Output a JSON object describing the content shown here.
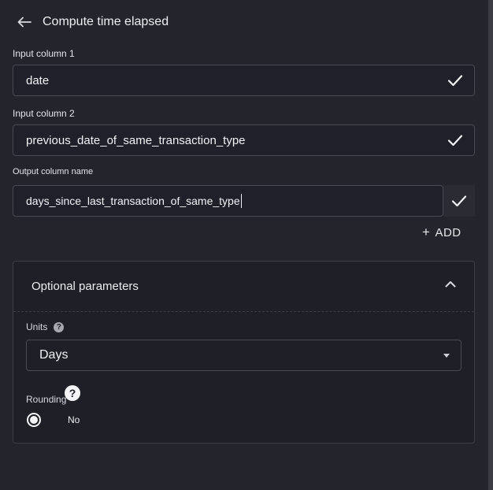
{
  "header": {
    "back_icon": "arrow-left-icon",
    "title": "Compute time elapsed"
  },
  "input1": {
    "label": "Input column 1",
    "value": "date",
    "icon": "check-icon"
  },
  "input2": {
    "label": "Input column 2",
    "value": "previous_date_of_same_transaction_type",
    "icon": "check-icon"
  },
  "output": {
    "label": "Output column name",
    "value": "days_since_last_transaction_of_same_type",
    "icon": "check-icon"
  },
  "add_button": {
    "icon": "plus-icon",
    "label": "ADD"
  },
  "optional": {
    "title": "Optional parameters",
    "expanded": true,
    "chevron_icon": "chevron-up-icon",
    "units": {
      "label": "Units",
      "help_icon": "help-icon",
      "selected": "Days"
    },
    "rounding": {
      "label": "Rounding",
      "help_icon": "help-icon",
      "option_label": "No",
      "selected": true
    }
  },
  "colors": {
    "background": "#24242c",
    "field_border": "#4a4a53",
    "text": "#e8e8ec"
  }
}
